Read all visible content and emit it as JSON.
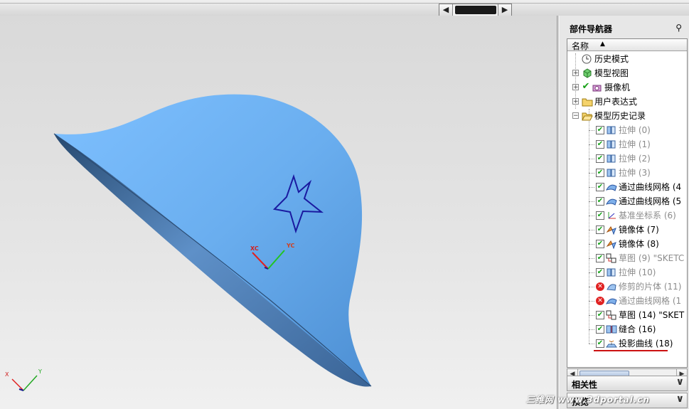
{
  "panel": {
    "title": "部件导航器",
    "column_name": "名称",
    "pin_icon": "pin-icon",
    "sections": [
      "相关性",
      "预览"
    ]
  },
  "viewport": {
    "axis_labels": {
      "xc": "XC",
      "yc": "YC",
      "x": "X",
      "y": "Y"
    }
  },
  "tree": {
    "top_nodes": [
      {
        "label": "历史模式",
        "icon": "clock-icon"
      },
      {
        "label": "模型视图",
        "icon": "model-views-icon",
        "expand": "+"
      },
      {
        "label": "摄像机",
        "icon": "camera-icon",
        "expand": "+"
      },
      {
        "label": "用户表达式",
        "icon": "folder-icon",
        "expand": "+"
      },
      {
        "label": "模型历史记录",
        "icon": "folder-open-icon",
        "expand": "−"
      }
    ],
    "features": [
      {
        "label": "拉伸 (0)",
        "icon": "extrude-icon",
        "state": "checked",
        "dim": true
      },
      {
        "label": "拉伸 (1)",
        "icon": "extrude-icon",
        "state": "checked",
        "dim": true
      },
      {
        "label": "拉伸 (2)",
        "icon": "extrude-icon",
        "state": "checked",
        "dim": true
      },
      {
        "label": "拉伸 (3)",
        "icon": "extrude-icon",
        "state": "checked",
        "dim": true
      },
      {
        "label": "通过曲线网格 (4",
        "icon": "mesh-surface-icon",
        "state": "checked",
        "dim": false
      },
      {
        "label": "通过曲线网格 (5",
        "icon": "mesh-surface-icon",
        "state": "checked",
        "dim": false
      },
      {
        "label": "基准坐标系 (6)",
        "icon": "datum-csys-icon",
        "state": "checked",
        "dim": true
      },
      {
        "label": "镜像体 (7)",
        "icon": "mirror-body-icon",
        "state": "checked",
        "dim": false
      },
      {
        "label": "镜像体 (8)",
        "icon": "mirror-body-icon",
        "state": "checked",
        "dim": false
      },
      {
        "label": "草图 (9) \"SKETC",
        "icon": "sketch-icon",
        "state": "checked",
        "dim": true
      },
      {
        "label": "拉伸 (10)",
        "icon": "extrude-icon",
        "state": "checked",
        "dim": true
      },
      {
        "label": "修剪的片体 (11)",
        "icon": "trimmed-sheet-icon",
        "state": "error",
        "dim": true
      },
      {
        "label": "通过曲线网格 (1",
        "icon": "mesh-surface-icon",
        "state": "error",
        "dim": true
      },
      {
        "label": "草图 (14) \"SKET",
        "icon": "sketch-icon",
        "state": "checked",
        "dim": false
      },
      {
        "label": "缝合 (16)",
        "icon": "sew-icon",
        "state": "checked",
        "dim": false
      },
      {
        "label": "投影曲线 (18)",
        "icon": "project-curve-icon",
        "state": "checked",
        "dim": false
      }
    ]
  },
  "watermark": "三维网 www.3dportal.cn",
  "colors": {
    "helmet": "#6fb3f5",
    "helmet_inner": "#3f6fa3",
    "star": "#1a1aa0",
    "error": "#e02222",
    "check": "#17a31a",
    "underline": "#cc1111"
  }
}
